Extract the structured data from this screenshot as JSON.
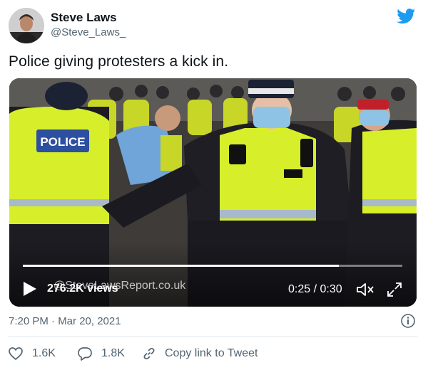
{
  "author": {
    "name": "Steve Laws",
    "handle": "@Steve_Laws_"
  },
  "tweet": {
    "text": "Police giving protesters a kick in.",
    "timestamp": "7:20 PM · Mar 20, 2021"
  },
  "video": {
    "watermark": "@SteveLawsReport.co.uk",
    "views": "276.2K views",
    "time": "0:25 / 0:30",
    "progress": 0.833,
    "vest_text": "POLICE"
  },
  "actions": {
    "likes": "1.6K",
    "replies": "1.8K",
    "copy_link_label": "Copy link to Tweet"
  },
  "colors": {
    "brand": "#1d9bf0",
    "hi_vis": "#d7ef2a",
    "text_secondary": "#536471"
  },
  "icons": [
    "twitter-bird-icon",
    "play-icon",
    "mute-icon",
    "fullscreen-icon",
    "info-icon",
    "heart-icon",
    "reply-icon",
    "link-icon"
  ]
}
